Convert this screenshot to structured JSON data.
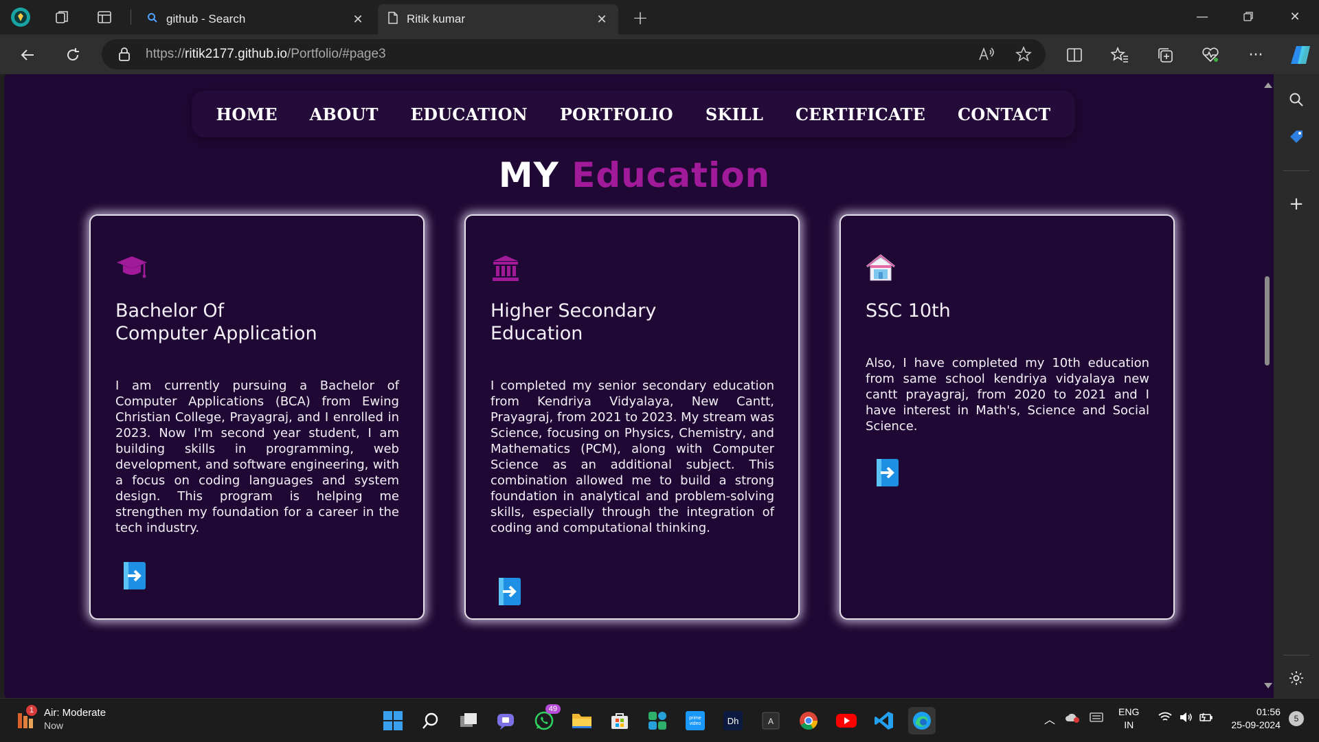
{
  "browser": {
    "tabs": [
      {
        "title": "github - Search",
        "icon": "search-icon"
      },
      {
        "title": "Ritik kumar",
        "icon": "page-icon",
        "active": true
      }
    ],
    "url_prefix": "https://",
    "url_host": "ritik2177.github.io",
    "url_path": "/Portfolio/#page3"
  },
  "site": {
    "nav": [
      "HOME",
      "ABOUT",
      "EDUCATION",
      "PORTFOLIO",
      "SKILL",
      "CERTIFICATE",
      "CONTACT"
    ],
    "title_part1": "MY",
    "title_part2": "Education",
    "accent_color": "#a01a9a",
    "background_color": "#1f0833",
    "cards": [
      {
        "icon": "graduation-cap-icon",
        "title_line1": "Bachelor Of",
        "title_line2": "Computer Application",
        "text": "I am currently pursuing a Bachelor of Computer Applications (BCA) from Ewing Christian College, Prayagraj, and I enrolled in 2023. Now I'm second year student, I am building skills in programming, web development, and software engineering, with a focus on coding languages and system design. This program is helping me strengthen my foundation for a career in the tech industry."
      },
      {
        "icon": "institution-icon",
        "title_line1": "Higher Secondary",
        "title_line2": "Education",
        "text": "I completed my senior secondary education from Kendriya Vidyalaya, New Cantt, Prayagraj, from 2021 to 2023. My stream was Science, focusing on Physics, Chemistry, and Mathematics (PCM), along with Computer Science as an additional subject. This combination allowed me to build a strong foundation in analytical and problem-solving skills, especially through the integration of coding and computational thinking."
      },
      {
        "icon": "school-icon",
        "title_line1": "SSC 10th",
        "title_line2": "",
        "text": "Also, I have completed my 10th education from same school kendriya vidyalaya new cantt prayagraj, from 2020 to 2021 and I have interest in Math's, Science and Social Science."
      }
    ]
  },
  "taskbar": {
    "weather_title": "Air: Moderate",
    "weather_sub": "Now",
    "weather_badge": "1",
    "whatsapp_badge": "49",
    "lang_line1": "ENG",
    "lang_line2": "IN",
    "time": "01:56",
    "date": "25-09-2024",
    "notification_count": "5"
  }
}
